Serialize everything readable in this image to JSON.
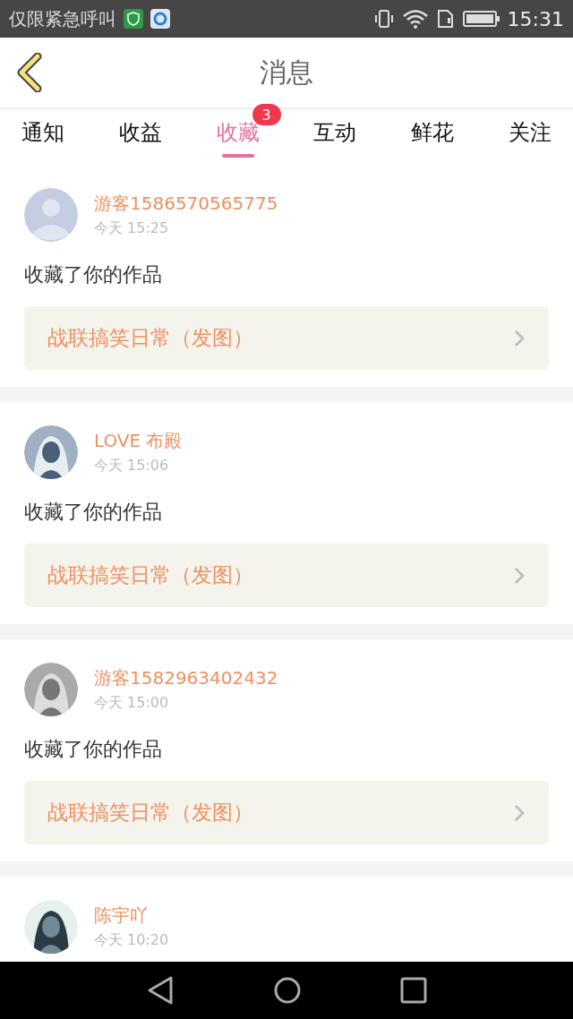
{
  "status_bar": {
    "carrier": "仅限紧急呼叫",
    "time": "15:31"
  },
  "header": {
    "title": "消息"
  },
  "tabs": [
    {
      "label": "通知",
      "selected": false
    },
    {
      "label": "收益",
      "selected": false
    },
    {
      "label": "收藏",
      "selected": true,
      "badge": "3"
    },
    {
      "label": "互动",
      "selected": false
    },
    {
      "label": "鲜花",
      "selected": false
    },
    {
      "label": "关注",
      "selected": false
    }
  ],
  "messages": [
    {
      "kind": "default",
      "name": "游客1586570565775",
      "time": "今天 15:25",
      "text": "收藏了你的作品",
      "link": "战联搞笑日常（发图）"
    },
    {
      "kind": "picture",
      "name": "LOVE 布殿",
      "time": "今天 15:06",
      "text": "收藏了你的作品",
      "link": "战联搞笑日常（发图）"
    },
    {
      "kind": "picture",
      "name": "游客1582963402432",
      "time": "今天 15:00",
      "text": "收藏了你的作品",
      "link": "战联搞笑日常（发图）"
    },
    {
      "kind": "picture",
      "name": "陈宇吖",
      "time": "今天 10:20"
    }
  ]
}
